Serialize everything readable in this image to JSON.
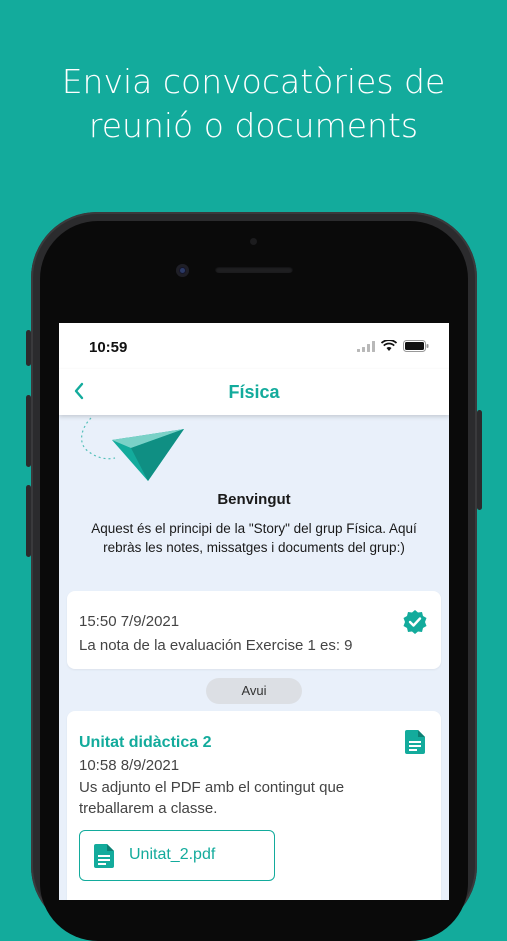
{
  "headline": [
    "Envia convocatòries de",
    "reunió o documents"
  ],
  "status_bar": {
    "time": "10:59"
  },
  "nav": {
    "back_icon": "chevron-left-icon",
    "title": "Física"
  },
  "welcome": {
    "title": "Benvingut",
    "text": "Aquest és el principi de la \"Story\" del grup Física. Aquí rebràs les notes, missatges i documents del grup:)"
  },
  "messages": [
    {
      "datetime": "15:50 7/9/2021",
      "text": "La nota de la evaluación Exercise 1 es: 9",
      "icon": "verified-check-icon"
    },
    {
      "title": "Unitat didàctica 2",
      "datetime": "10:58 8/9/2021",
      "text_line1": "Us adjunto el PDF amb el contingut que",
      "text_line2": "treballarem a classe.",
      "icon": "document-icon",
      "attachment": {
        "name": "Unitat_2.pdf",
        "icon": "file-icon"
      }
    }
  ],
  "day_separator": "Avui",
  "colors": {
    "accent": "#13ab9c",
    "background": "#13ab9c",
    "chat_bg": "#e9f0fa"
  }
}
